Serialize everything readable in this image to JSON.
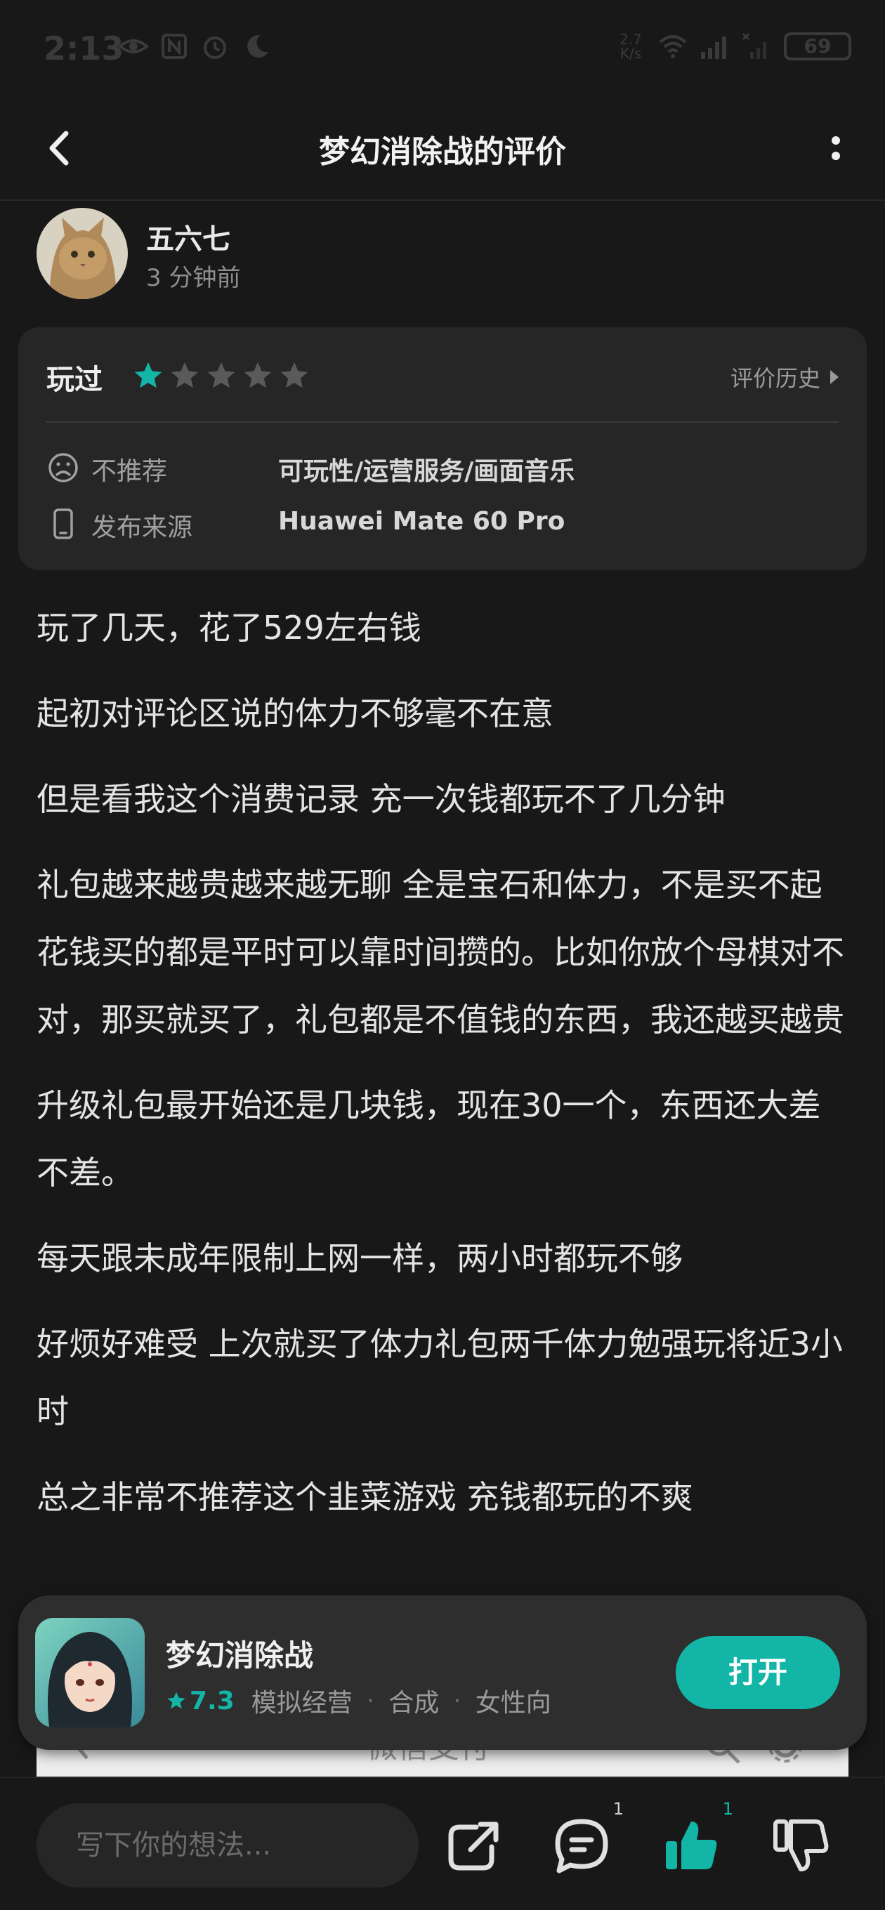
{
  "status_bar": {
    "time": "2:13",
    "net_speed_value": "2.7",
    "net_speed_unit": "K/s",
    "battery": "69"
  },
  "header": {
    "title": "梦幻消除战的评价"
  },
  "user": {
    "name": "五六七",
    "time": "3 分钟前"
  },
  "rating_card": {
    "played_label": "玩过",
    "stars_filled": 1,
    "stars_total": 5,
    "history_label": "评价历史",
    "rows": [
      {
        "icon": "sad-face-icon",
        "label": "不推荐",
        "value": "可玩性/运营服务/画面音乐"
      },
      {
        "icon": "phone-icon",
        "label": "发布来源",
        "value": "Huawei Mate 60 Pro"
      }
    ]
  },
  "review": {
    "paragraphs": [
      "玩了几天，花了529左右钱",
      "起初对评论区说的体力不够毫不在意",
      "但是看我这个消费记录 充一次钱都玩不了几分钟",
      "礼包越来越贵越来越无聊 全是宝石和体力，不是买不起 花钱买的都是平时可以靠时间攒的。比如你放个母棋对不对，那买就买了，礼包都是不值钱的东西，我还越买越贵",
      "升级礼包最开始还是几块钱，现在30一个，东西还大差不差。",
      "每天跟未成年限制上网一样，两小时都玩不够",
      "好烦好难受 上次就买了体力礼包两千体力勉强玩将近3小时",
      "总之非常不推荐这个韭菜游戏 充钱都玩的不爽"
    ],
    "embedded_title": "微信支付"
  },
  "app_card": {
    "name": "梦幻消除战",
    "score": "7.3",
    "tags": [
      "模拟经营",
      "合成",
      "女性向"
    ],
    "open_label": "打开"
  },
  "bottom_bar": {
    "input_placeholder": "写下你的想法...",
    "comment_count": "1",
    "like_count": "1"
  },
  "colors": {
    "accent": "#13b5a7",
    "background": "#181818",
    "card": "#262626"
  }
}
